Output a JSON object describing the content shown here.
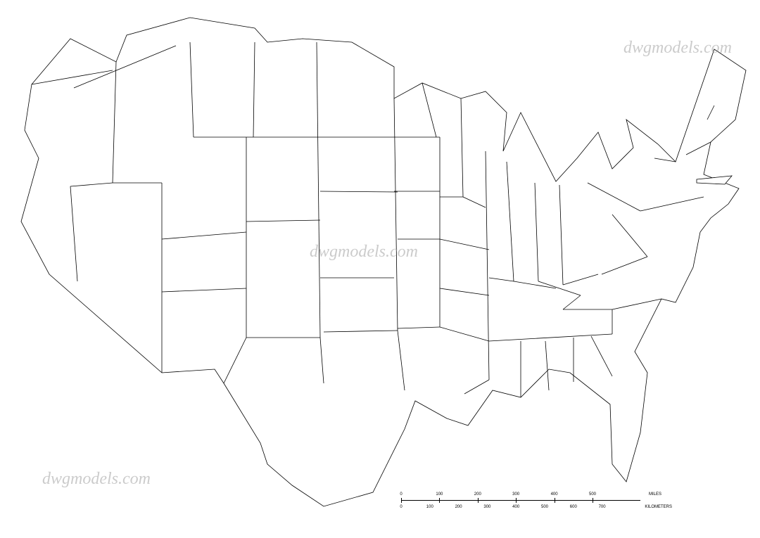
{
  "map": {
    "title": "Map of the United States of America",
    "type": "outline",
    "projection": "conic",
    "fill": "#ffffff",
    "stroke": "#000000",
    "states_shown": "contiguous-48",
    "labels_visible": false
  },
  "watermarks": {
    "text": "dwgmodels.com",
    "positions": [
      "top-right",
      "center",
      "bottom-left"
    ]
  },
  "scale": {
    "top_row": {
      "ticks": [
        "0",
        "100",
        "200",
        "300",
        "400",
        "500"
      ],
      "unit": "MILES"
    },
    "bottom_row": {
      "ticks": [
        "0",
        "100",
        "200",
        "300",
        "400",
        "500",
        "600",
        "700"
      ],
      "unit": "KILOMETERS"
    }
  }
}
